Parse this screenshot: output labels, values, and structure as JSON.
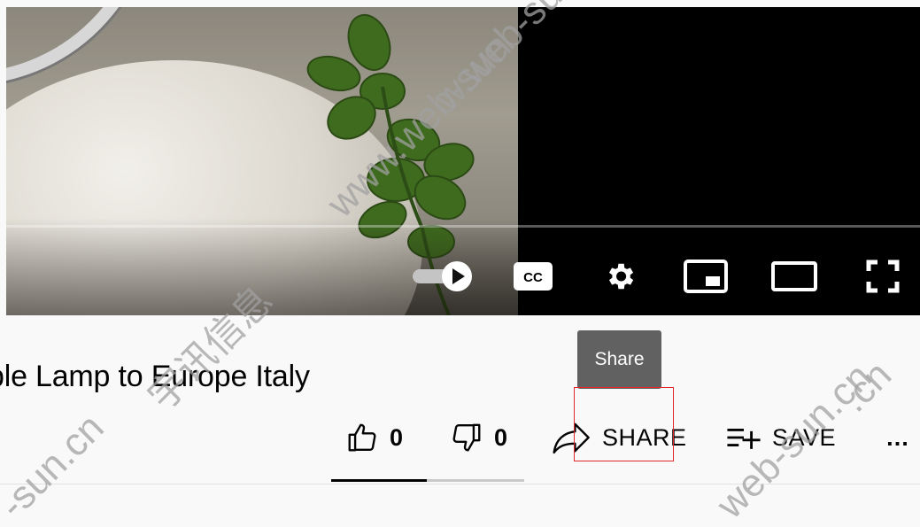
{
  "video": {
    "controls": {
      "autoplay_toggle": "autoplay-toggle",
      "subtitles": "CC",
      "settings": "settings",
      "miniplayer": "miniplayer",
      "theater": "theater-mode",
      "fullscreen": "fullscreen"
    }
  },
  "tooltip": {
    "text": "Share"
  },
  "title": "ble Lamp to Europe Italy",
  "actions": {
    "like_count": "0",
    "dislike_count": "0",
    "share_label": "SHARE",
    "save_label": "SAVE",
    "more_label": "…"
  },
  "watermark": [
    "-sun.cn",
    "www.web-sun",
    "宇讯信息",
    ".cn",
    "web-sun.cn",
    "w.web-sun.c"
  ],
  "colors": {
    "highlight": "#e3262d",
    "tooltip_bg": "#616161",
    "text": "#030303"
  }
}
